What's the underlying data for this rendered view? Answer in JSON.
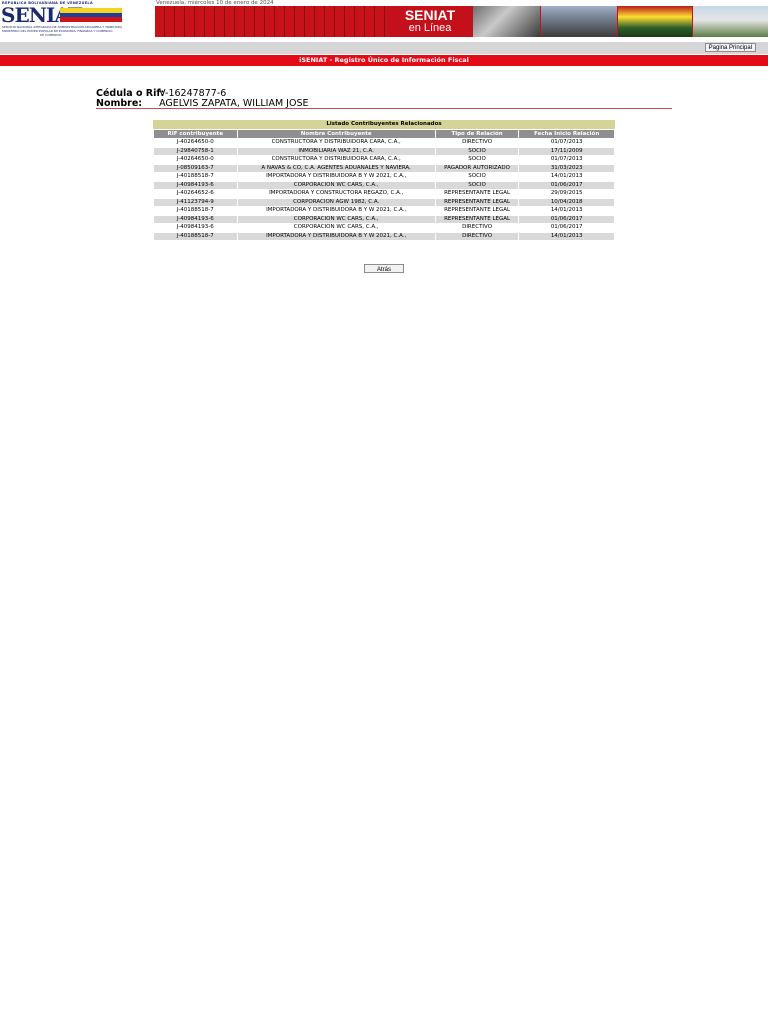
{
  "header": {
    "logo_country_line": "REPÚBLICA BOLIVARIANA DE VENEZUELA",
    "logo_wordmark": "SENIAT",
    "logo_ministry_line1": "SERVICIO NACIONAL INTEGRADO DE ADMINISTRACIÓN ADUANERA Y TRIBUTARIA",
    "logo_ministry_line2": "MINISTERIO DEL PODER POPULAR DE ECONOMÍA, FINANZAS Y COMERCIO",
    "logo_ministry_line3": "DE COMERCIO",
    "flag_colors": [
      "#f4d21f",
      "#1b3f9a",
      "#d0121b"
    ],
    "date": "Venezuela, miércoles 10 de enero de 2024",
    "banner_title": "SENIAT",
    "banner_subtitle": "en Línea"
  },
  "toolbar": {
    "home_button": "Pagina Principal"
  },
  "section_title": "iSENIAT - Registro Único de Información Fiscal",
  "identity": {
    "rif_label": "Cédula o Rif:",
    "rif_value": "V-16247877-6",
    "name_label": "Nombre:",
    "name_value": "AGELVIS ZAPATA, WILLIAM JOSE"
  },
  "table": {
    "caption": "Listado Contribuyentes Relacionados",
    "headers": [
      "RIF contribuyente",
      "Nombre Contribuyente",
      "Tipo de Relación",
      "Fecha Inicio Relación"
    ],
    "rows": [
      [
        "J-40264650-0",
        "CONSTRUCTORA Y DISTRIBUIDORA CARA, C.A.,",
        "DIRECTIVO",
        "01/07/2013"
      ],
      [
        "J-29840758-1",
        "INMOBILIARIA WAZ 21, C.A.",
        "SOCIO",
        "17/11/2009"
      ],
      [
        "J-40264650-0",
        "CONSTRUCTORA Y DISTRIBUIDORA CARA, C.A.,",
        "SOCIO",
        "01/07/2013"
      ],
      [
        "J-08509163-7",
        "A NAVAS & CO, C.A. AGENTES ADUANALES Y NAVIERA,",
        "PAGADOR AUTORIZADO",
        "31/03/2023"
      ],
      [
        "J-40188518-7",
        "IMPORTADORA Y DISTRIBUIDORA B Y W 2021, C.A.,",
        "SOCIO",
        "14/01/2013"
      ],
      [
        "J-40984193-6",
        "CORPORACION WC CARS, C.A.,",
        "SOCIO",
        "01/06/2017"
      ],
      [
        "J-40264652-6",
        "IMPORTADORA Y CONSTRUCTORA REGAZO, C.A.,",
        "REPRESENTANTE LEGAL",
        "29/09/2015"
      ],
      [
        "J-41123794-9",
        "CORPORACION AGW 1982, C.A.",
        "REPRESENTANTE LEGAL",
        "10/04/2018"
      ],
      [
        "J-40188518-7",
        "IMPORTADORA Y DISTRIBUIDORA B Y W 2021, C.A.,",
        "REPRESENTANTE LEGAL",
        "14/01/2013"
      ],
      [
        "J-40984193-6",
        "CORPORACION WC CARS, C.A.,",
        "REPRESENTANTE LEGAL",
        "01/06/2017"
      ],
      [
        "J-40984193-6",
        "CORPORACION WC CARS, C.A.,",
        "DIRECTIVO",
        "01/06/2017"
      ],
      [
        "J-40188518-7",
        "IMPORTADORA Y DISTRIBUIDORA B Y W 2021, C.A.,",
        "DIRECTIVO",
        "14/01/2013"
      ]
    ]
  },
  "back_button": "Atrás"
}
